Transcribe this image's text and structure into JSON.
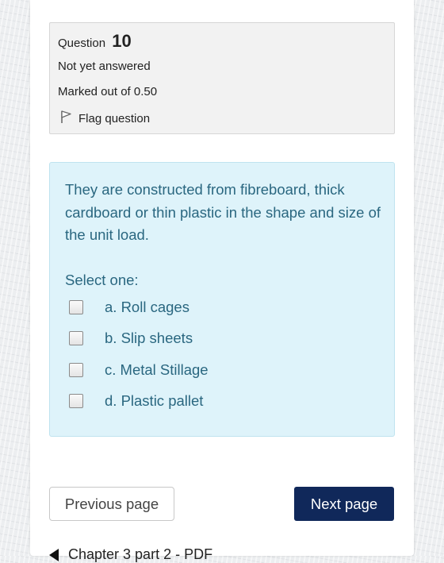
{
  "question": {
    "label": "Question",
    "number": "10",
    "status": "Not yet answered",
    "marks": "Marked out of 0.50",
    "flag_label": "Flag question"
  },
  "content": {
    "text": "They are constructed from fibreboard, thick cardboard or thin plastic in the shape and size of the unit load.",
    "prompt": "Select one:",
    "options": [
      {
        "label": "a. Roll cages",
        "checked": false
      },
      {
        "label": "b. Slip sheets",
        "checked": false
      },
      {
        "label": "c. Metal Stillage",
        "checked": false
      },
      {
        "label": "d. Plastic pallet",
        "checked": false
      }
    ]
  },
  "navigation": {
    "previous_label": "Previous page",
    "next_label": "Next page",
    "bottom_link": "Chapter 3 part 2 - PDF"
  },
  "colors": {
    "content_bg": "#def3fa",
    "content_text": "#2a6780",
    "next_button_bg": "#10285a",
    "info_bg": "#f2f2f2"
  }
}
